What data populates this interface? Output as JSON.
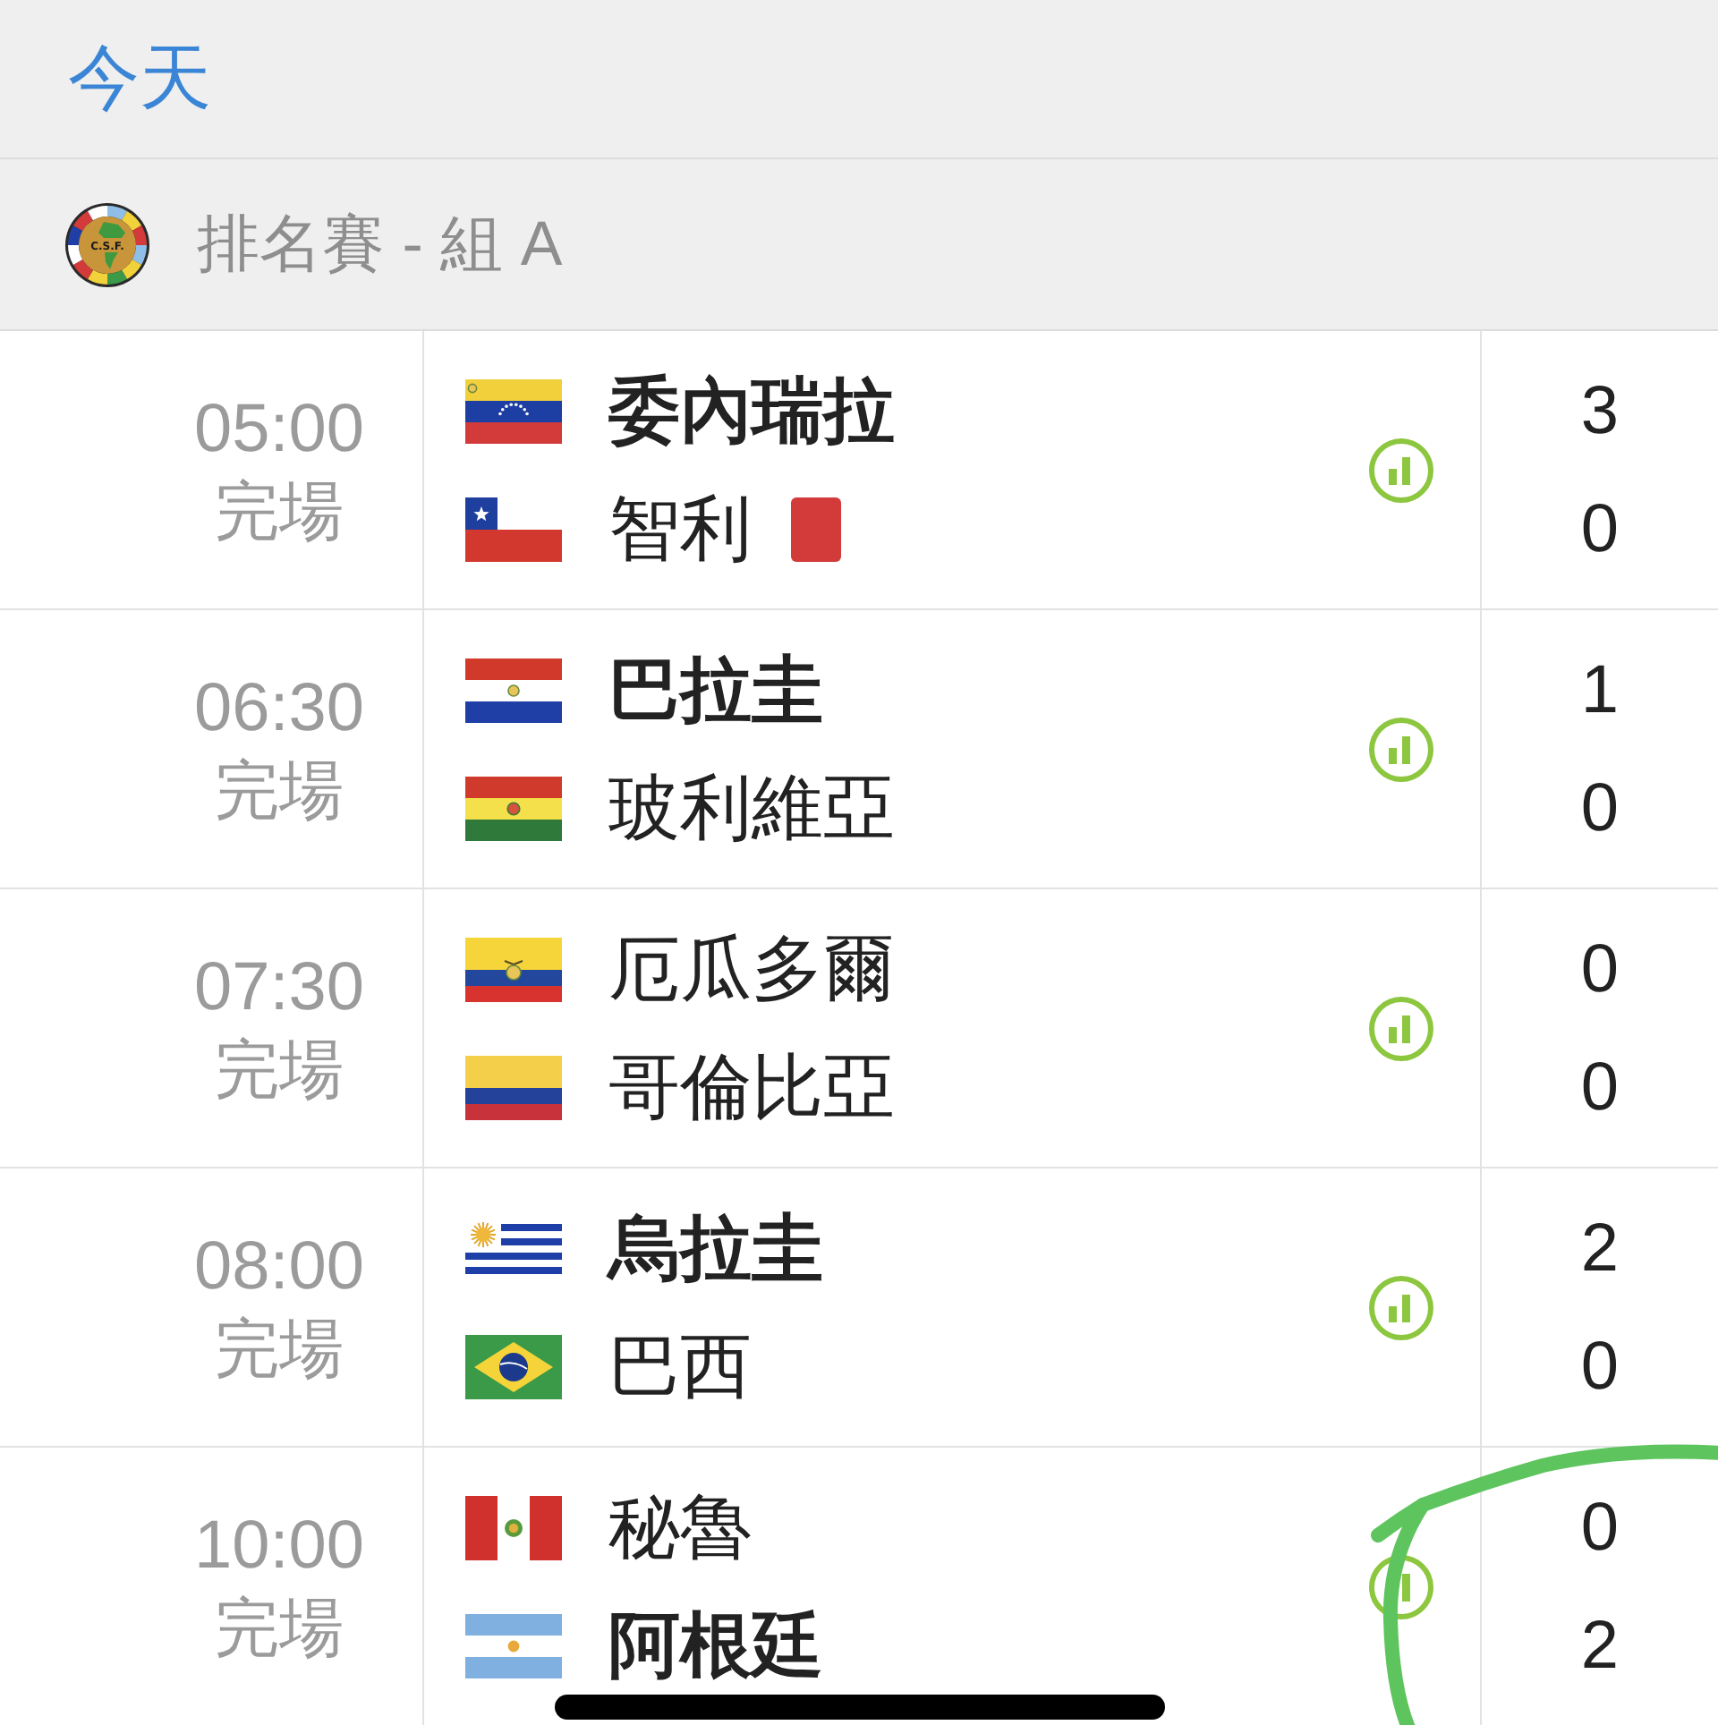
{
  "header": {
    "title": "今天"
  },
  "league": {
    "logo_text": "C.S.F.",
    "title": "排名賽 - 組 A"
  },
  "matches": [
    {
      "time": "05:00",
      "status": "完場",
      "teams": [
        {
          "kind": "venezuela",
          "name": "委內瑞拉",
          "winner": true,
          "red_card": false,
          "score": "3"
        },
        {
          "kind": "chile",
          "name": "智利",
          "winner": false,
          "red_card": true,
          "score": "0"
        }
      ]
    },
    {
      "time": "06:30",
      "status": "完場",
      "teams": [
        {
          "kind": "paraguay",
          "name": "巴拉圭",
          "winner": true,
          "red_card": false,
          "score": "1"
        },
        {
          "kind": "bolivia",
          "name": "玻利維亞",
          "winner": false,
          "red_card": false,
          "score": "0"
        }
      ]
    },
    {
      "time": "07:30",
      "status": "完場",
      "teams": [
        {
          "kind": "ecuador",
          "name": "厄瓜多爾",
          "winner": false,
          "red_card": false,
          "score": "0"
        },
        {
          "kind": "colombia",
          "name": "哥倫比亞",
          "winner": false,
          "red_card": false,
          "score": "0"
        }
      ]
    },
    {
      "time": "08:00",
      "status": "完場",
      "teams": [
        {
          "kind": "uruguay",
          "name": "烏拉圭",
          "winner": true,
          "red_card": false,
          "score": "2"
        },
        {
          "kind": "brazil",
          "name": "巴西",
          "winner": false,
          "red_card": false,
          "score": "0"
        }
      ]
    },
    {
      "time": "10:00",
      "status": "完場",
      "teams": [
        {
          "kind": "peru",
          "name": "秘魯",
          "winner": false,
          "red_card": false,
          "score": "0"
        },
        {
          "kind": "argentina",
          "name": "阿根廷",
          "winner": true,
          "red_card": false,
          "score": "2"
        }
      ]
    }
  ]
}
